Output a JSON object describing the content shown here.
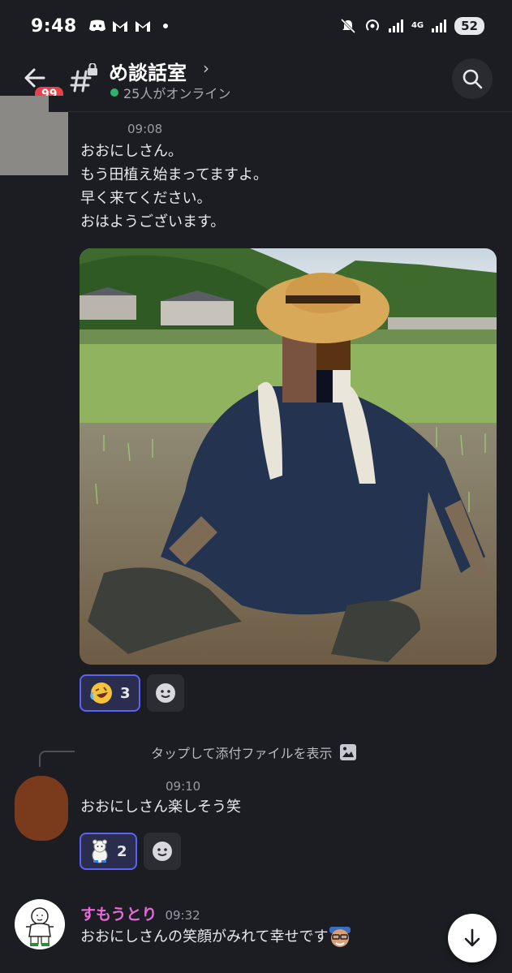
{
  "status_bar": {
    "time": "9:48",
    "notif_icons": [
      "discord-icon",
      "gmail-icon",
      "gmail-icon"
    ],
    "network": "4G",
    "battery": "52"
  },
  "header": {
    "unread_badge": "99",
    "channel_name": "め談話室",
    "chevron": "›",
    "online_text": "25人がオンライン",
    "online_color": "#2fb36b"
  },
  "messages": [
    {
      "time": "09:08",
      "lines": [
        "おおにしさん。",
        "もう田植え始まってますよ。",
        "早く来てください。",
        "おはようございます。"
      ],
      "attachment": "photo",
      "reactions": [
        {
          "emoji": "rolling-on-floor-laughing-emoji",
          "count": "3"
        }
      ]
    },
    {
      "reply_preview": "タップして添付ファイルを表示",
      "time": "09:10",
      "lines": [
        "おおにしさん楽しそう笑"
      ],
      "reactions": [
        {
          "emoji": "white-bear-sticker",
          "count": "2"
        }
      ]
    },
    {
      "username": "すもうとり",
      "username_color": "#e66ad8",
      "time": "09:32",
      "lines": [
        "おおにしさんの笑顔がみれて幸せです"
      ],
      "trailing_emoji": "custom-face-emoji"
    }
  ],
  "accent": "#5865f2"
}
